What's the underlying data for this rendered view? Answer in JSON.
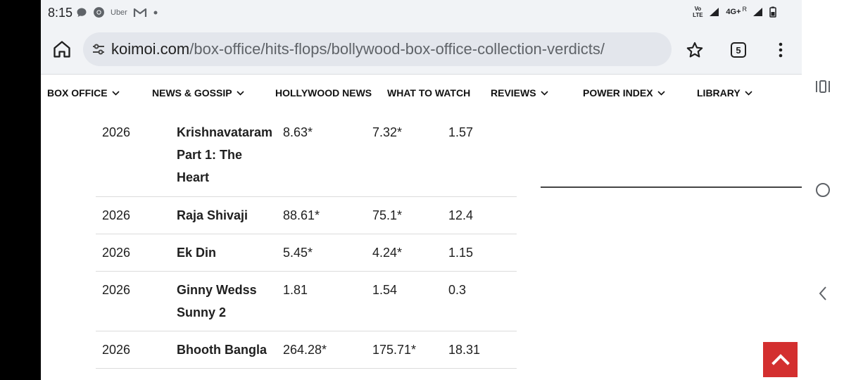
{
  "status_bar": {
    "time": "8:15",
    "notification_icons": [
      "chat-icon",
      "chrome-icon",
      "uber-icon",
      "gmail-icon",
      "dot-icon"
    ],
    "uber_label": "Uber",
    "volte_label": "Vo LTE",
    "network_label": "4G+",
    "roaming_label": "R"
  },
  "browser": {
    "url_domain": "koimoi.com",
    "url_path": "/box-office/hits-flops/bollywood-box-office-collection-verdicts/",
    "tab_count": "5"
  },
  "site_nav": {
    "items": [
      {
        "label": "BOX OFFICE",
        "has_dropdown": true
      },
      {
        "label": "NEWS & GOSSIP",
        "has_dropdown": true
      },
      {
        "label": "HOLLYWOOD NEWS",
        "has_dropdown": false
      },
      {
        "label": "WHAT TO WATCH",
        "has_dropdown": false
      },
      {
        "label": "REVIEWS",
        "has_dropdown": true
      },
      {
        "label": "POWER INDEX",
        "has_dropdown": true
      },
      {
        "label": "LIBRARY",
        "has_dropdown": true
      }
    ]
  },
  "table": {
    "rows": [
      {
        "year": "2026",
        "name": "Krishnavataram Part 1: The Heart",
        "v1": "8.63*",
        "v2": "7.32*",
        "v3": "1.57"
      },
      {
        "year": "2026",
        "name": "Raja Shivaji",
        "v1": "88.61*",
        "v2": "75.1*",
        "v3": "12.4"
      },
      {
        "year": "2026",
        "name": "Ek Din",
        "v1": "5.45*",
        "v2": "4.24*",
        "v3": "1.15"
      },
      {
        "year": "2026",
        "name": "Ginny Wedss Sunny 2",
        "v1": "1.81",
        "v2": "1.54",
        "v3": "0.3"
      },
      {
        "year": "2026",
        "name": "Bhooth Bangla",
        "v1": "264.28*",
        "v2": "175.71*",
        "v3": "18.31"
      }
    ]
  },
  "colors": {
    "scroll_top_button": "#d32f2f",
    "browser_chrome": "#f1f3f6"
  }
}
